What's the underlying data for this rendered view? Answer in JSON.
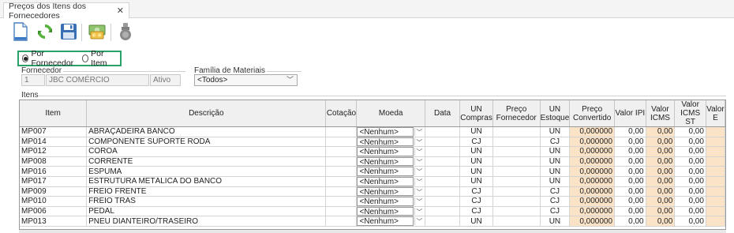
{
  "window": {
    "tab_title": "Preços dos Itens dos Fornecedores",
    "close_glyph": "✕"
  },
  "toolbar": {
    "buttons": [
      {
        "name": "new-document-icon"
      },
      {
        "name": "refresh-icon"
      },
      {
        "name": "save-icon"
      },
      {
        "name": "money-icon"
      },
      {
        "name": "disabled-icon"
      }
    ]
  },
  "filter": {
    "radio_fornecedor": "Por Fornecedor",
    "radio_item": "Por Item",
    "selected": "fornecedor"
  },
  "fornecedor": {
    "label": "Fornecedor",
    "code": "1",
    "name": "JBC COMÉRCIO",
    "status": "Ativo"
  },
  "familia": {
    "label": "Família de Materiais",
    "selected": "<Todos>"
  },
  "itens": {
    "label": "Itens",
    "columns": [
      "Item",
      "Descrição",
      "Cotação",
      "Moeda",
      "Data",
      "UN Compras",
      "Preço Fornecedor",
      "UN Estoque",
      "Preço Convertido",
      "Valor IPI",
      "Valor ICMS",
      "Valor ICMS ST",
      "Valor E"
    ],
    "rows": [
      {
        "item": "MP007",
        "desc": "ABRAÇADEIRA BANCO",
        "moeda": "<Nenhum>",
        "un_compras": "UN",
        "un_estoque": "UN",
        "preco_conv": "0,000000",
        "ipi": "0,00",
        "icms": "0,00",
        "icms_st": "0,00"
      },
      {
        "item": "MP014",
        "desc": "COMPONENTE SUPORTE RODA",
        "moeda": "<Nenhum>",
        "un_compras": "CJ",
        "un_estoque": "CJ",
        "preco_conv": "0,000000",
        "ipi": "0,00",
        "icms": "0,00",
        "icms_st": "0,00"
      },
      {
        "item": "MP012",
        "desc": "COROA",
        "moeda": "<Nenhum>",
        "un_compras": "UN",
        "un_estoque": "UN",
        "preco_conv": "0,000000",
        "ipi": "0,00",
        "icms": "0,00",
        "icms_st": "0,00"
      },
      {
        "item": "MP008",
        "desc": "CORRENTE",
        "moeda": "<Nenhum>",
        "un_compras": "UN",
        "un_estoque": "UN",
        "preco_conv": "0,000000",
        "ipi": "0,00",
        "icms": "0,00",
        "icms_st": "0,00"
      },
      {
        "item": "MP016",
        "desc": "ESPUMA",
        "moeda": "<Nenhum>",
        "un_compras": "UN",
        "un_estoque": "UN",
        "preco_conv": "0,000000",
        "ipi": "0,00",
        "icms": "0,00",
        "icms_st": "0,00"
      },
      {
        "item": "MP017",
        "desc": "ESTRUTURA METÁLICA DO BANCO",
        "moeda": "<Nenhum>",
        "un_compras": "UN",
        "un_estoque": "UN",
        "preco_conv": "0,000000",
        "ipi": "0,00",
        "icms": "0,00",
        "icms_st": "0,00"
      },
      {
        "item": "MP009",
        "desc": "FREIO FRENTE",
        "moeda": "<Nenhum>",
        "un_compras": "CJ",
        "un_estoque": "CJ",
        "preco_conv": "0,000000",
        "ipi": "0,00",
        "icms": "0,00",
        "icms_st": "0,00"
      },
      {
        "item": "MP010",
        "desc": "FREIO TRÁS",
        "moeda": "<Nenhum>",
        "un_compras": "CJ",
        "un_estoque": "CJ",
        "preco_conv": "0,000000",
        "ipi": "0,00",
        "icms": "0,00",
        "icms_st": "0,00"
      },
      {
        "item": "MP006",
        "desc": "PEDAL",
        "moeda": "<Nenhum>",
        "un_compras": "CJ",
        "un_estoque": "CJ",
        "preco_conv": "0,000000",
        "ipi": "0,00",
        "icms": "0,00",
        "icms_st": "0,00"
      },
      {
        "item": "MP013",
        "desc": "PNEU DIANTEIRO/TRASEIRO",
        "moeda": "<Nenhum>",
        "un_compras": "UN",
        "un_estoque": "UN",
        "preco_conv": "0,000000",
        "ipi": "0,00",
        "icms": "0,00",
        "icms_st": "0,00"
      }
    ]
  },
  "colors": {
    "highlight_border": "#2aa06b",
    "peach_cell": "#fbe3c7"
  }
}
